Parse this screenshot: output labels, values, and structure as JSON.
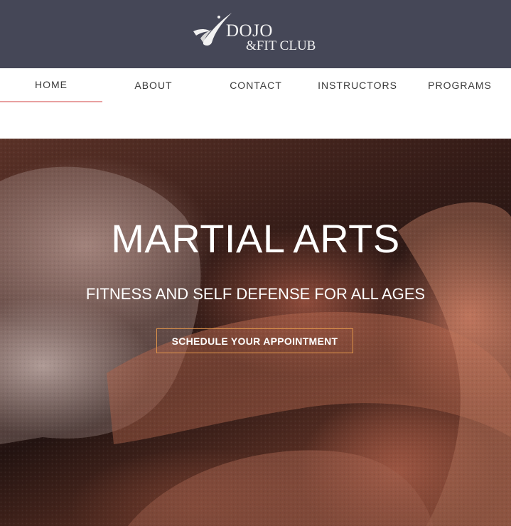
{
  "brand": {
    "line1": "DOJO",
    "line2": "&FIT CLUB",
    "header_color": "#454757",
    "logo_icon": "swoosh-emblem-icon"
  },
  "nav": {
    "items": [
      {
        "label": "HOME",
        "active": true
      },
      {
        "label": "ABOUT",
        "active": false
      },
      {
        "label": "CONTACT",
        "active": false
      },
      {
        "label": "INSTRUCTORS",
        "active": false
      },
      {
        "label": "PROGRAMS",
        "active": false
      }
    ],
    "active_underline_color": "#e8a0a0"
  },
  "hero": {
    "title": "MARTIAL ARTS",
    "subtitle": "FITNESS AND SELF DEFENSE FOR ALL AGES",
    "cta_label": "SCHEDULE YOUR APPOINTMENT",
    "cta_border_color": "#e0954a"
  }
}
